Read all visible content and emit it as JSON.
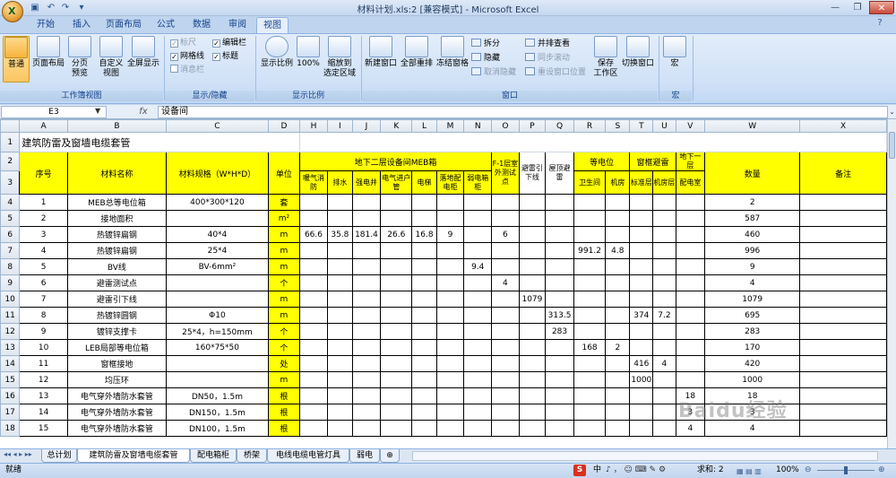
{
  "window": {
    "title": "材料计划.xls:2  [兼容模式] - Microsoft Excel"
  },
  "qat": {
    "save_icon": "save-icon",
    "undo_icon": "undo-icon",
    "redo_icon": "redo-icon"
  },
  "tabs": [
    {
      "label": "开始"
    },
    {
      "label": "插入"
    },
    {
      "label": "页面布局"
    },
    {
      "label": "公式"
    },
    {
      "label": "数据"
    },
    {
      "label": "审阅"
    },
    {
      "label": "视图"
    }
  ],
  "ribbon": {
    "workbook_views": {
      "label": "工作簿视图",
      "normal": "普通",
      "page_layout": "页面布局",
      "page_break": "分页\n预览",
      "custom_views": "自定义\n视图",
      "full_screen": "全屏显示"
    },
    "show_hide": {
      "label": "显示/隐藏",
      "ruler": "标尺",
      "gridlines": "网格线",
      "message_bar": "消息栏",
      "formula_bar": "编辑栏",
      "headings": "标题"
    },
    "zoom": {
      "label": "显示比例",
      "zoom": "显示比例",
      "hundred": "100%",
      "zoom_selection": "缩放到\n选定区域"
    },
    "window": {
      "label": "窗口",
      "new_window": "新建窗口",
      "arrange_all": "全部重排",
      "freeze_panes": "冻结窗格",
      "split": "拆分",
      "hide": "隐藏",
      "unhide": "取消隐藏",
      "side_by_side": "并排查看",
      "sync_scroll": "同步滚动",
      "reset_position": "重设窗口位置",
      "save_workspace": "保存\n工作区",
      "switch_windows": "切换窗口"
    },
    "macros": {
      "label": "宏",
      "macros": "宏"
    }
  },
  "formula_bar": {
    "cell_ref": "E3",
    "fx": "fx",
    "value": "设备间"
  },
  "columns": [
    "A",
    "B",
    "C",
    "D",
    "H",
    "I",
    "J",
    "K",
    "L",
    "M",
    "N",
    "O",
    "P",
    "Q",
    "R",
    "S",
    "T",
    "U",
    "V",
    "W",
    "X"
  ],
  "sheet": {
    "title": "建筑防雷及窗墙电缆套管",
    "headers": {
      "seq": "序号",
      "name": "材料名称",
      "spec": "材料规格（W*H*D）",
      "unit": "单位",
      "meb_group": "地下二层设备间MEB箱",
      "f1_group": "F-1层室外测试点",
      "down_group": "避雷引下线",
      "roof_group": "屋顶避雷",
      "equi_group": "等电位",
      "window_group": "窗框避雷",
      "b1_group": "地下一层",
      "qty": "数量",
      "remark": "备注",
      "sub": [
        "暖气消防",
        "排水",
        "强电井",
        "电气进户管",
        "电梯",
        "落地配电柜",
        "弱电箱柜",
        "",
        "",
        "",
        "卫生间",
        "机房",
        "标准层",
        "机房层",
        "配电室"
      ]
    },
    "rows": [
      {
        "r": "4",
        "seq": "1",
        "name": "MEB总等电位箱",
        "spec": "400*300*120",
        "unit": "套",
        "vals": [
          "",
          "",
          "",
          "",
          "",
          "",
          "",
          "",
          "",
          "",
          "",
          "",
          "",
          "",
          ""
        ],
        "qty": "2"
      },
      {
        "r": "5",
        "seq": "2",
        "name": "接地面积",
        "spec": "",
        "unit": "m²",
        "vals": [
          "",
          "",
          "",
          "",
          "",
          "",
          "",
          "",
          "",
          "",
          "",
          "",
          "",
          "",
          ""
        ],
        "qty": "587"
      },
      {
        "r": "6",
        "seq": "3",
        "name": "热镀锌扁钢",
        "spec": "40*4",
        "unit": "m",
        "vals": [
          "66.6",
          "35.8",
          "181.4",
          "26.6",
          "16.8",
          "9",
          "",
          "6",
          "",
          "",
          "",
          "",
          "",
          "",
          ""
        ],
        "qty": "460"
      },
      {
        "r": "7",
        "seq": "4",
        "name": "热镀锌扁钢",
        "spec": "25*4",
        "unit": "m",
        "vals": [
          "",
          "",
          "",
          "",
          "",
          "",
          "",
          "",
          "",
          "",
          "991.2",
          "4.8",
          "",
          "",
          ""
        ],
        "qty": "996"
      },
      {
        "r": "8",
        "seq": "5",
        "name": "BV线",
        "spec": "BV-6mm²",
        "unit": "m",
        "vals": [
          "",
          "",
          "",
          "",
          "",
          "",
          "9.4",
          "",
          "",
          "",
          "",
          "",
          "",
          "",
          ""
        ],
        "qty": "9"
      },
      {
        "r": "9",
        "seq": "6",
        "name": "避雷测试点",
        "spec": "",
        "unit": "个",
        "vals": [
          "",
          "",
          "",
          "",
          "",
          "",
          "",
          "4",
          "",
          "",
          "",
          "",
          "",
          "",
          ""
        ],
        "qty": "4"
      },
      {
        "r": "10",
        "seq": "7",
        "name": "避雷引下线",
        "spec": "",
        "unit": "m",
        "vals": [
          "",
          "",
          "",
          "",
          "",
          "",
          "",
          "",
          "1079",
          "",
          "",
          "",
          "",
          "",
          ""
        ],
        "qty": "1079"
      },
      {
        "r": "11",
        "seq": "8",
        "name": "热镀锌圆钢",
        "spec": "Φ10",
        "unit": "m",
        "vals": [
          "",
          "",
          "",
          "",
          "",
          "",
          "",
          "",
          "",
          "313.5",
          "",
          "",
          "374",
          "7.2",
          ""
        ],
        "qty": "695"
      },
      {
        "r": "12",
        "seq": "9",
        "name": "镀锌支撑卡",
        "spec": "25*4，h=150mm",
        "unit": "个",
        "vals": [
          "",
          "",
          "",
          "",
          "",
          "",
          "",
          "",
          "",
          "283",
          "",
          "",
          "",
          "",
          ""
        ],
        "qty": "283"
      },
      {
        "r": "13",
        "seq": "10",
        "name": "LEB局部等电位箱",
        "spec": "160*75*50",
        "unit": "个",
        "vals": [
          "",
          "",
          "",
          "",
          "",
          "",
          "",
          "",
          "",
          "",
          "168",
          "2",
          "",
          "",
          ""
        ],
        "qty": "170"
      },
      {
        "r": "14",
        "seq": "11",
        "name": "窗框接地",
        "spec": "",
        "unit": "处",
        "vals": [
          "",
          "",
          "",
          "",
          "",
          "",
          "",
          "",
          "",
          "",
          "",
          "",
          "416",
          "4",
          ""
        ],
        "qty": "420"
      },
      {
        "r": "15",
        "seq": "12",
        "name": "均压环",
        "spec": "",
        "unit": "m",
        "vals": [
          "",
          "",
          "",
          "",
          "",
          "",
          "",
          "",
          "",
          "",
          "",
          "",
          "1000",
          "",
          ""
        ],
        "qty": "1000"
      },
      {
        "r": "16",
        "seq": "13",
        "name": "电气穿外墙防水套管",
        "spec": "DN50，1.5m",
        "unit": "根",
        "vals": [
          "",
          "",
          "",
          "",
          "",
          "",
          "",
          "",
          "",
          "",
          "",
          "",
          "",
          "",
          "18"
        ],
        "qty": "18"
      },
      {
        "r": "17",
        "seq": "14",
        "name": "电气穿外墙防水套管",
        "spec": "DN150，1.5m",
        "unit": "根",
        "vals": [
          "",
          "",
          "",
          "",
          "",
          "",
          "",
          "",
          "",
          "",
          "",
          "",
          "",
          "",
          "3"
        ],
        "qty": "3"
      },
      {
        "r": "18",
        "seq": "15",
        "name": "电气穿外墙防水套管",
        "spec": "DN100，1.5m",
        "unit": "根",
        "vals": [
          "",
          "",
          "",
          "",
          "",
          "",
          "",
          "",
          "",
          "",
          "",
          "",
          "",
          "",
          "4"
        ],
        "qty": "4"
      }
    ]
  },
  "sheet_tabs": [
    "总计划",
    "建筑防雷及窗墙电缆套管",
    "配电箱柜",
    "桥架",
    "电线电缆电管灯具",
    "弱电"
  ],
  "status": {
    "ready": "就绪",
    "sum": "求和: 2",
    "zoom": "100%",
    "ime": "中"
  },
  "watermark": "Baidu经验",
  "colors": {
    "header_fill": "#ffff00",
    "ribbon_text": "#15428b",
    "active_view": "#fbc564"
  }
}
